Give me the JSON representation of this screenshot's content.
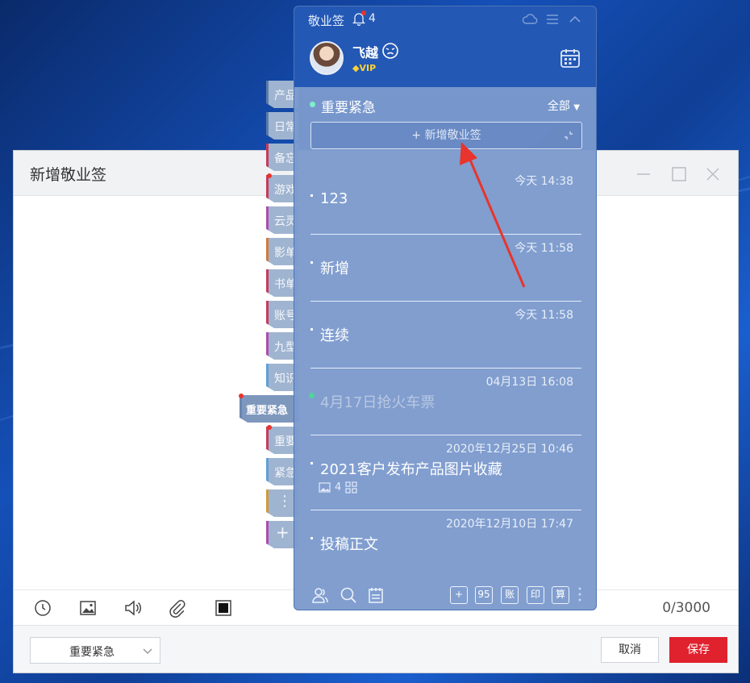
{
  "editor": {
    "title": "新增敬业签",
    "char_count": "0/3000",
    "category_select": "重要紧急",
    "cancel_label": "取消",
    "save_label": "保存"
  },
  "category_tabs": [
    {
      "label": "产品"
    },
    {
      "label": "日常"
    },
    {
      "label": "备忘"
    },
    {
      "label": "游戏"
    },
    {
      "label": "云灵"
    },
    {
      "label": "影单"
    },
    {
      "label": "书单"
    },
    {
      "label": "账号"
    },
    {
      "label": "九型"
    },
    {
      "label": "知识"
    },
    {
      "label": "重要紧急"
    },
    {
      "label": "重要"
    },
    {
      "label": "紧急"
    },
    {
      "label": "⋮"
    },
    {
      "label": "+"
    }
  ],
  "widget": {
    "app_name": "敬业签",
    "notification_count": "4",
    "username": "飞越",
    "vip_label": "VIP",
    "section_title": "重要紧急",
    "filter_label": "全部",
    "new_note_label": "+ 新增敬业签",
    "notes": [
      {
        "time": "今天 14:38",
        "title": "123"
      },
      {
        "time": "今天 11:58",
        "title": "新增"
      },
      {
        "time": "今天 11:58",
        "title": "连续"
      },
      {
        "time": "04月13日 16:08",
        "title": "4月17日抢火车票"
      },
      {
        "time": "2020年12月25日 10:46",
        "title": "2021客户发布产品图片收藏",
        "attachment_count": "4"
      },
      {
        "time": "2020年12月10日 17:47",
        "title": "投稿正文"
      }
    ],
    "bottom_buttons": [
      "95",
      "账",
      "印",
      "算"
    ]
  },
  "colors": {
    "accent": "#2458b5",
    "save_button": "#e0222e",
    "completed_dot": "#4fd49c"
  }
}
